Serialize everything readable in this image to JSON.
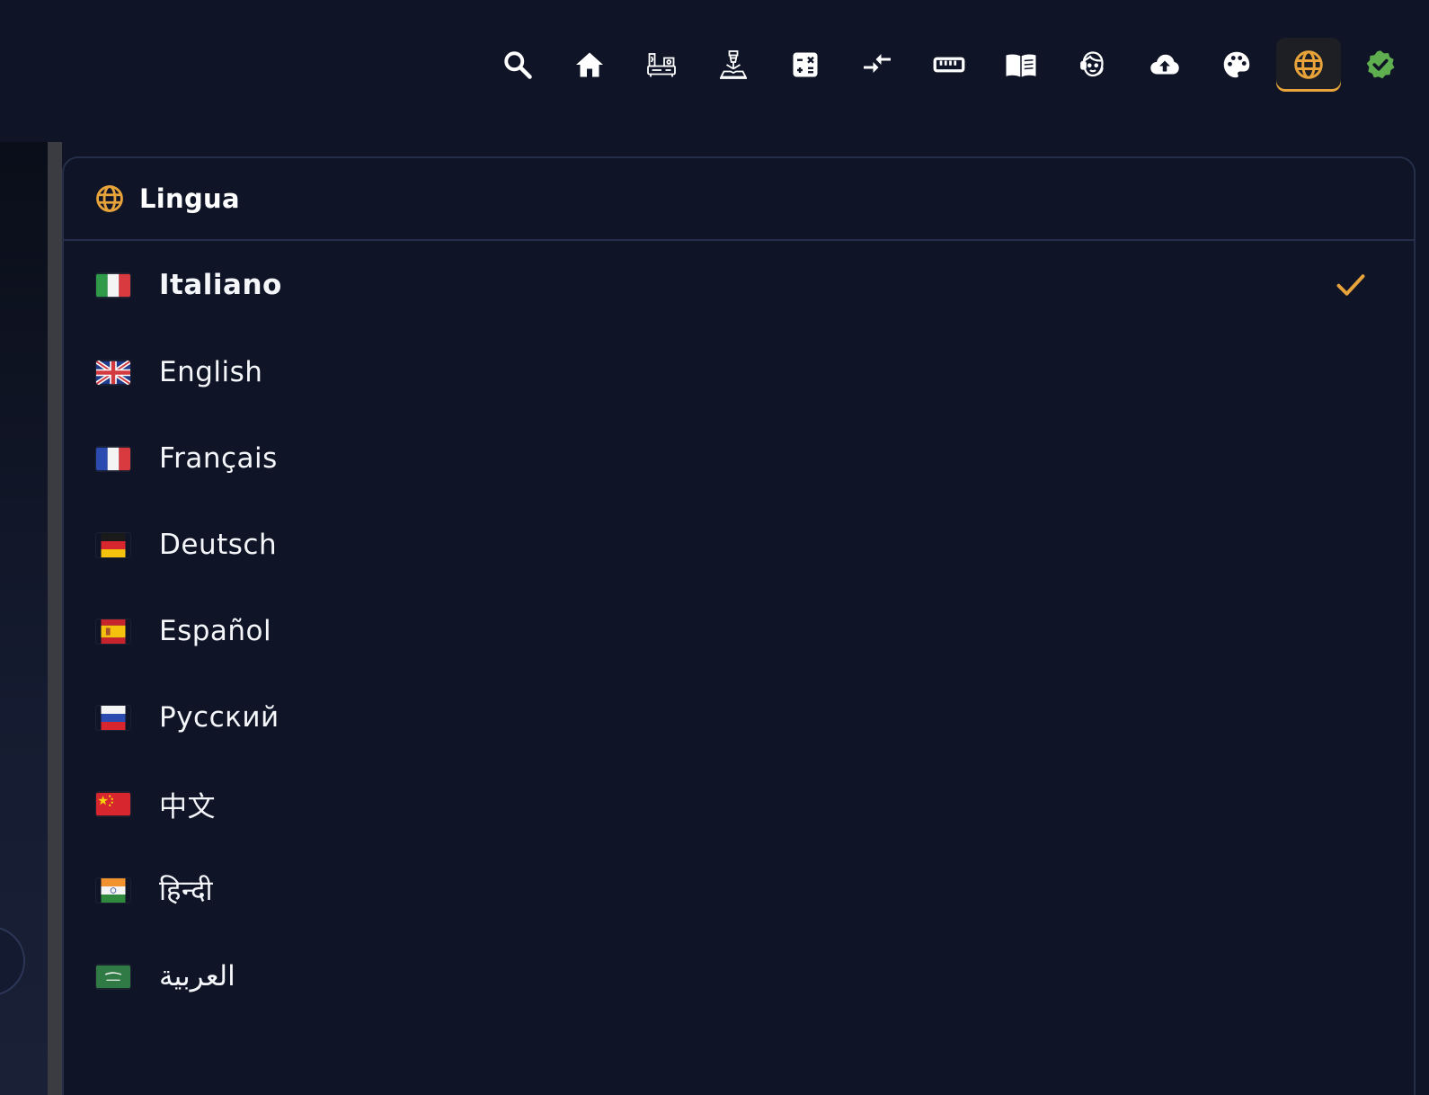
{
  "toolbar": {
    "tools": [
      {
        "name": "search-icon"
      },
      {
        "name": "home-icon"
      },
      {
        "name": "machine-panel-icon"
      },
      {
        "name": "laser-cutter-icon"
      },
      {
        "name": "calculator-icon"
      },
      {
        "name": "compress-arrows-icon"
      },
      {
        "name": "ruler-icon"
      },
      {
        "name": "manual-book-icon"
      },
      {
        "name": "support-agent-icon"
      },
      {
        "name": "cloud-upload-icon"
      },
      {
        "name": "palette-icon"
      },
      {
        "name": "globe-icon",
        "active": true
      },
      {
        "name": "verified-badge-icon"
      }
    ]
  },
  "menu": {
    "title": "Lingua",
    "items": [
      {
        "label": "Italiano",
        "flag": "it",
        "selected": true
      },
      {
        "label": "English",
        "flag": "gb"
      },
      {
        "label": "Français",
        "flag": "fr"
      },
      {
        "label": "Deutsch",
        "flag": "de"
      },
      {
        "label": "Español",
        "flag": "es"
      },
      {
        "label": "Русский",
        "flag": "ru"
      },
      {
        "label": "中文",
        "flag": "cn"
      },
      {
        "label": "हिन्दी",
        "flag": "in"
      },
      {
        "label": "العربية",
        "flag": "sa"
      }
    ]
  },
  "colors": {
    "background": "#0f1527",
    "accent": "#e8a33a",
    "verified": "#5fae4f",
    "border": "#262f49"
  }
}
